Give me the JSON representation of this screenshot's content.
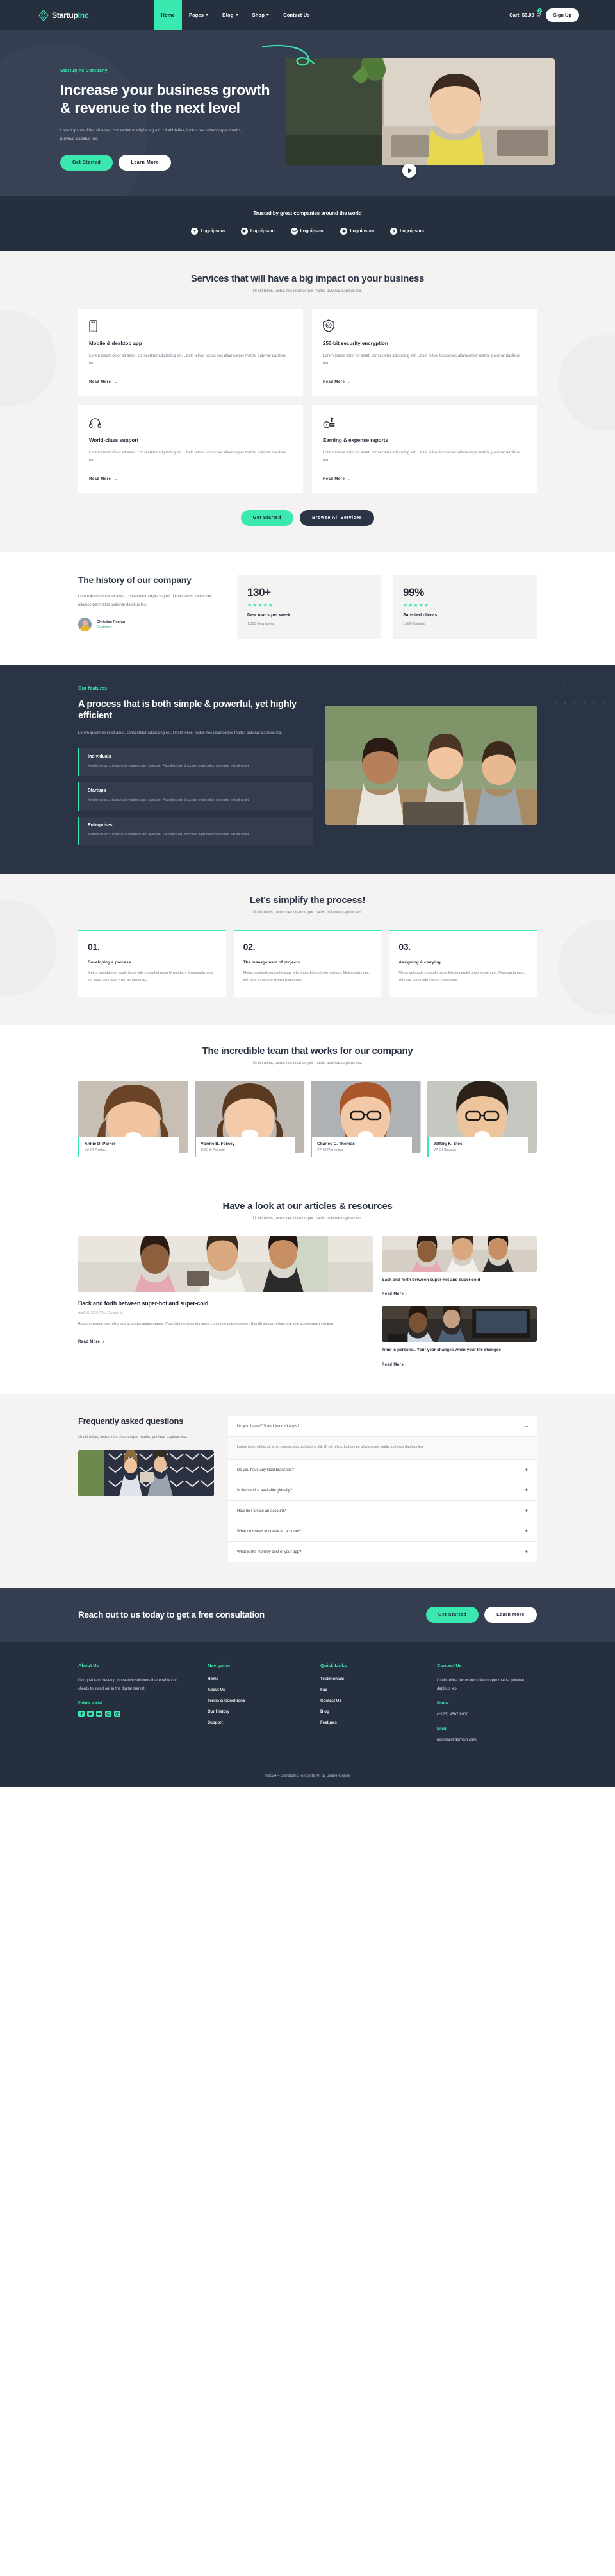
{
  "header": {
    "brand": {
      "name": "Startup",
      "accent": "Inc",
      "icon": "diamond-logo-icon"
    },
    "nav": [
      {
        "label": "Home",
        "active": true,
        "caret": false
      },
      {
        "label": "Pages",
        "active": false,
        "caret": true
      },
      {
        "label": "Blog",
        "active": false,
        "caret": true
      },
      {
        "label": "Shop",
        "active": false,
        "caret": true
      },
      {
        "label": "Contact Us",
        "active": false,
        "caret": false
      }
    ],
    "cart_label": "Cart:  $0.00",
    "cart_badge": "0",
    "signup_label": "Sign Up"
  },
  "hero": {
    "eyebrow": "Startupinc Company",
    "title": "Increase your business growth & revenue to the next level",
    "paragraph": "Lorem ipsum dolor sit amet, consectetur adipiscing elit. Ut elit tellus, luctus nec ullamcorper mattis, pulvinar dapibus leo.",
    "primary_btn": "Get Started",
    "secondary_btn": "Learn More",
    "play_icon": "play-button-icon"
  },
  "trusted": {
    "title": "Trusted by great companies around the world",
    "logos": [
      {
        "label": "Logoipsum",
        "icon": "bolt-icon"
      },
      {
        "label": "Logoipsum",
        "icon": "flower-icon"
      },
      {
        "label": "Logoipsum",
        "icon": "waves-icon"
      },
      {
        "label": "Logoipsum",
        "icon": "flower-icon"
      },
      {
        "label": "Logoipsum",
        "icon": "bolt-icon"
      }
    ]
  },
  "services": {
    "title": "Services that will have a big impact on your business",
    "subtitle": "Ut elit tellus, luctus nec ullamcorper mattis, pulvinar dapibus leo.",
    "read_more": "Read More",
    "cards": [
      {
        "icon": "mobile-phone-icon",
        "title": "Mobile & desktop app",
        "text": "Lorem ipsum dolor sit amet, consectetur adipiscing elit. Ut elit tellus, luctus nec ullamcorper mattis, pulvinar dapibus leo."
      },
      {
        "icon": "shield-check-icon",
        "title": "256-bit security encryption",
        "text": "Lorem ipsum dolor sit amet, consectetur adipiscing elit. Ut elit tellus, luctus nec ullamcorper mattis, pulvinar dapibus leo."
      },
      {
        "icon": "headset-support-icon",
        "title": "World-class support",
        "text": "Lorem ipsum dolor sit amet, consectetur adipiscing elit. Ut elit tellus, luctus nec ullamcorper mattis, pulvinar dapibus leo."
      },
      {
        "icon": "coins-report-icon",
        "title": "Earning & expense reports",
        "text": "Lorem ipsum dolor sit amet, consectetur adipiscing elit. Ut elit tellus, luctus nec ullamcorper mattis, pulvinar dapibus leo."
      }
    ],
    "btn_primary": "Get Started",
    "btn_dark": "Browse All Services"
  },
  "history": {
    "title": "The history of our company",
    "paragraph": "Lorem ipsum dolor sit amet, consectetur adipiscing elit. Ut elit tellus, luctus nec ullamcorper mattis, pulvinar dapibus leo.",
    "person_name": "Christian Regran",
    "person_role": "Customer",
    "stats": [
      {
        "number": "130+",
        "stars": "★★★★★",
        "label": "New users per week",
        "sub": "1,300 New users"
      },
      {
        "number": "99%",
        "stars": "★★★★★",
        "label": "Satisfied clients",
        "sub": "1,800 Ratings"
      }
    ]
  },
  "features": {
    "eyebrow": "Our features",
    "title": "A process that is both simple & powerful, yet highly efficient",
    "paragraph": "Lorem ipsum dolor sit amet, consectetur adipiscing elit. Ut elit tellus, luctus nec ullamcorper mattis, pulvinar dapibus leo.",
    "items": [
      {
        "title": "Individuals",
        "text": "Morbi non arcu risus quis varius quam quisque. Faucibus nisl tincidunt eget nullam non nisi est sit amet."
      },
      {
        "title": "Startups",
        "text": "Morbi non arcu risus quis varius quam quisque. Faucibus nisl tincidunt eget nullam non nisi est sit amet."
      },
      {
        "title": "Enterprises",
        "text": "Morbi non arcu risus quis varius quam quisque. Faucibus nisl tincidunt eget nullam non nisi est sit amet."
      }
    ]
  },
  "simplify": {
    "title": "Let's simplify the process!",
    "subtitle": "Ut elit tellus, luctus nec ullamcorper mattis, pulvinar dapibus leo.",
    "cards": [
      {
        "num": "01.",
        "title": "Developing a process",
        "text": "Metus vulputate eu scelerisque felis imperdiet proin fermentum. Malesuada nunc vel risus commodo viverra maecenas."
      },
      {
        "num": "02.",
        "title": "The management of projects",
        "text": "Metus vulputate eu scelerisque felis imperdiet proin fermentum. Malesuada nunc vel risus commodo viverra maecenas."
      },
      {
        "num": "03.",
        "title": "Assigning & carrying",
        "text": "Metus vulputate eu scelerisque felis imperdiet proin fermentum. Malesuada nunc vel risus commodo viverra maecenas."
      }
    ]
  },
  "team": {
    "title": "The incredible team that works for our company",
    "subtitle": "Ut elit tellus, luctus nec ullamcorper mattis, pulvinar dapibus leo.",
    "members": [
      {
        "name": "Annie D. Parker",
        "role": "Vp Of Product"
      },
      {
        "name": "Valerie B. Forney",
        "role": "CEO & Founder"
      },
      {
        "name": "Charles C. Thomas",
        "role": "VP Of Marketing"
      },
      {
        "name": "Jeffery K. Stec",
        "role": "VP Of Support"
      }
    ]
  },
  "articles": {
    "title": "Have a look at our articles & resources",
    "subtitle": "Ut elit tellus, luctus nec ullamcorper mattis, pulvinar dapibus leo.",
    "read_more": "Read More",
    "main": {
      "title": "Back and forth between super-hot and super-cold",
      "meta": "April 10, 2023 /// No Comments",
      "text": "Rutrum quisque non tellus orci ac auctor augue mauris. Vulputate mi sit amet mauris commodo quis imperdiet. Blandit aliquam etiam erat velit scelerisque in dictum"
    },
    "side": [
      {
        "title": "Back and forth between super-hot and super-cold"
      },
      {
        "title": "Time is personal. Your year changes when your life changes"
      }
    ]
  },
  "faq": {
    "title": "Frequently asked questions",
    "paragraph": "Ut elit tellus, luctus nec ullamcorper mattis, pulvinar dapibus leo.",
    "items": [
      {
        "q": "Do you have iOS and Android apps?",
        "sign": "–",
        "open": true,
        "a": "Lorem ipsum dolor sit amet, consectetur adipiscing elit. Ut elit tellus, luctus nec ullamcorper mattis, pulvinar dapibus leo."
      },
      {
        "q": "Do you have any local branches?",
        "sign": "+",
        "open": false,
        "a": ""
      },
      {
        "q": "Is the service available globally?",
        "sign": "+",
        "open": false,
        "a": ""
      },
      {
        "q": "How do I create an account?",
        "sign": "+",
        "open": false,
        "a": ""
      },
      {
        "q": "What do I need to create an account?",
        "sign": "+",
        "open": false,
        "a": ""
      },
      {
        "q": "What is the monthly cost of your app?",
        "sign": "+",
        "open": false,
        "a": ""
      }
    ]
  },
  "cta": {
    "title": "Reach out to us today to get a free consultation",
    "primary_btn": "Get Started",
    "secondary_btn": "Learn More"
  },
  "footer": {
    "about": {
      "heading": "About Us",
      "text": "Our goal is to develop innovative solutions that enable our clients to stand out in the digital market.",
      "follow_label": "Follow social",
      "socials": [
        "facebook-icon",
        "twitter-icon",
        "youtube-icon",
        "wordpress-icon",
        "dribbble-icon"
      ]
    },
    "navigation": {
      "heading": "Navigation",
      "links": [
        "Home",
        "About Us",
        "Terms & Conditions",
        "Our History",
        "Support"
      ]
    },
    "quick_links": {
      "heading": "Quick Links",
      "links": [
        "Testimonials",
        "Faq",
        "Contact Us",
        "Blog",
        "Features"
      ]
    },
    "contact": {
      "heading": "Contact Us",
      "text": "Ut elit tellus, luctus nec ullamcorper mattis, pulvinar dapibus leo.",
      "phone_label": "Phone",
      "phone_value": "(+123) 4567 8900",
      "email_label": "Email",
      "email_value": "noemail@domain.com"
    },
    "copyright": "©2024 – StartupInc Template Kit by BimberOnline"
  },
  "colors": {
    "accent": "#3ae8b0",
    "dark": "#262f3e",
    "hero_dark": "#343e50",
    "light_bg": "#f4f3f1"
  }
}
